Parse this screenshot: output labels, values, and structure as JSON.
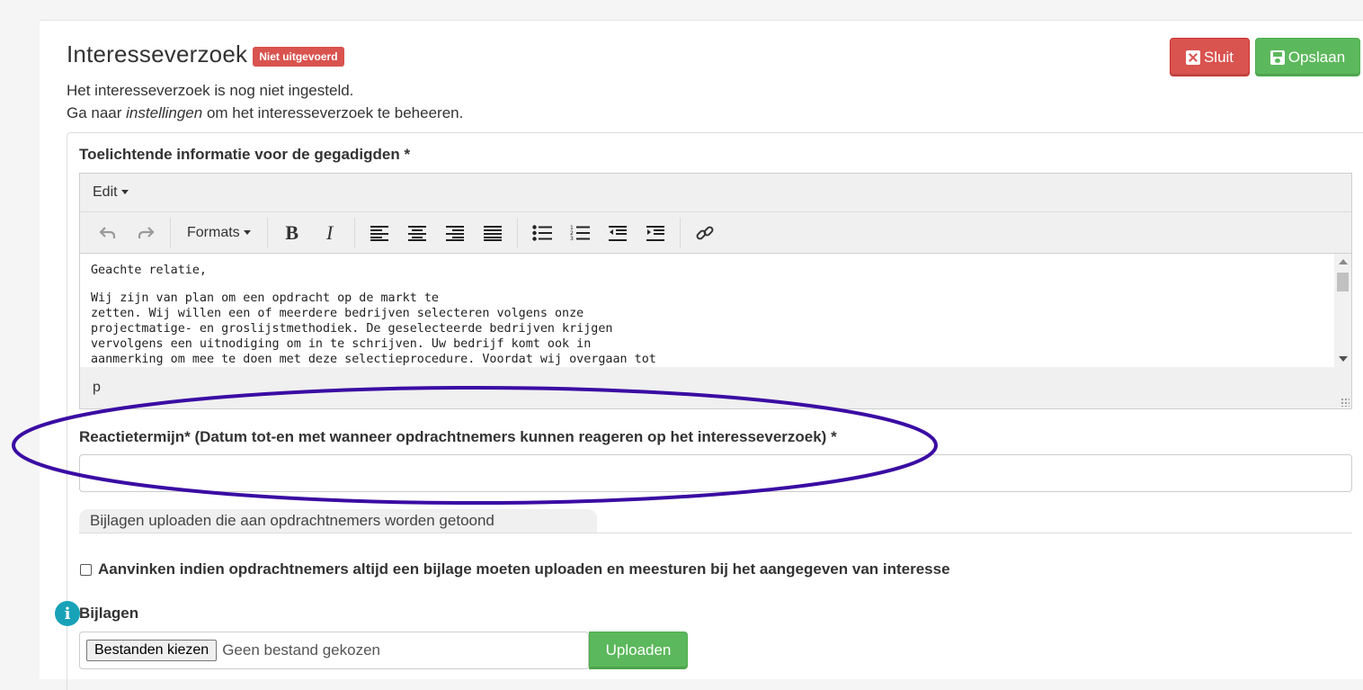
{
  "header": {
    "title": "Interesseverzoek",
    "status_badge": "Niet uitgevoerd",
    "line1": "Het interesseverzoek is nog niet ingesteld.",
    "line2_prefix": "Ga naar ",
    "line2_link": "instellingen",
    "line2_suffix": " om het interesseverzoek te beheeren."
  },
  "actions": {
    "close_label": "Sluit",
    "save_label": "Opslaan",
    "close_color": "#d9534f",
    "save_color": "#5cb85c"
  },
  "editor": {
    "label": "Toelichtende informatie voor de gegadigden *",
    "menu_edit": "Edit",
    "formats_label": "Formats",
    "bold_glyph": "B",
    "italic_glyph": "I",
    "toolbar_icons": [
      "undo-icon",
      "redo-icon",
      "bold-icon",
      "italic-icon",
      "align-left-icon",
      "align-center-icon",
      "align-right-icon",
      "align-justify-icon",
      "bullet-list-icon",
      "numbered-list-icon",
      "outdent-icon",
      "indent-icon",
      "link-icon"
    ],
    "content_greeting": "Geachte relatie,",
    "content_lines": [
      "Wij zijn van plan om een opdracht op de markt te",
      "zetten. Wij willen een of meerdere bedrijven selecteren volgens onze",
      "projectmatige- en groslijstmethodiek. De geselecteerde bedrijven krijgen",
      "vervolgens een uitnodiging om in te schrijven. Uw bedrijf komt ook in",
      "aanmerking om mee te doen met deze selectieprocedure. Voordat wij overgaan tot"
    ],
    "status_path": "p"
  },
  "reaction": {
    "label": "Reactietermijn* (Datum tot-en met wanneer opdrachtnemers kunnen reageren op het interesseverzoek) *",
    "value": "",
    "highlight_color": "#3a0ca3"
  },
  "attachments_tab": {
    "label": "Bijlagen uploaden die aan opdrachtnemers worden getoond"
  },
  "checkbox": {
    "label": "Aanvinken indien opdrachtnemers altijd een bijlage moeten uploaden en meesturen bij het aangegeven van interesse",
    "checked": false
  },
  "attachments": {
    "label": "Bijlagen",
    "info_glyph": "i",
    "choose_button": "Bestanden kiezen",
    "no_file_text": "Geen bestand gekozen",
    "upload_button": "Uploaden"
  }
}
